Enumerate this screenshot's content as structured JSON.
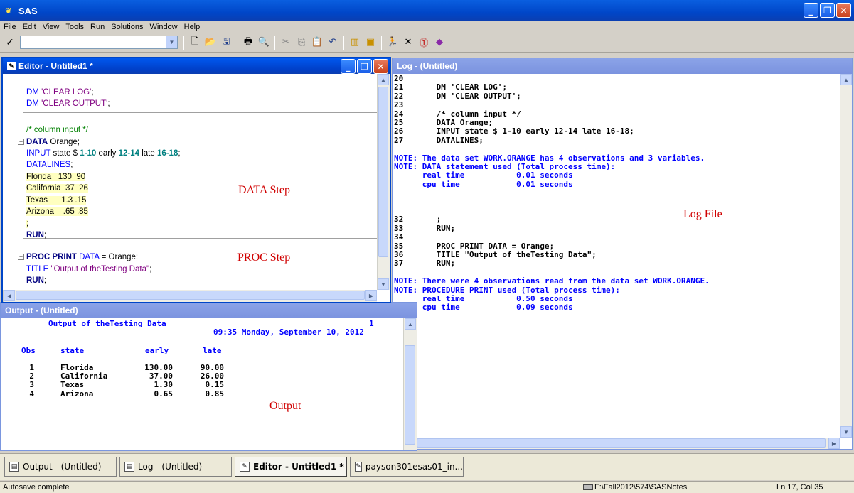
{
  "app": {
    "title": "SAS",
    "icon": "sas-app-icon"
  },
  "menu": [
    "File",
    "Edit",
    "View",
    "Tools",
    "Run",
    "Solutions",
    "Window",
    "Help"
  ],
  "toolbar": {
    "command_value": "",
    "icons": [
      "new-icon",
      "open-icon",
      "save-icon",
      "print-icon",
      "print-preview-icon",
      "cut-icon",
      "copy-icon",
      "paste-icon",
      "undo-icon",
      "new-library-icon",
      "explorer-icon",
      "submit-icon",
      "clear-icon",
      "break-icon",
      "help-icon"
    ]
  },
  "editor": {
    "title": "Editor - Untitled1 *",
    "lines": [
      {
        "parts": [
          {
            "t": "DM ",
            "c": "bl"
          },
          {
            "t": "'CLEAR LOG'",
            "c": "st"
          },
          {
            "t": ";",
            "c": ""
          }
        ]
      },
      {
        "parts": [
          {
            "t": "DM ",
            "c": "bl"
          },
          {
            "t": "'CLEAR OUTPUT'",
            "c": "st"
          },
          {
            "t": ";",
            "c": ""
          }
        ]
      },
      {
        "parts": []
      },
      {
        "parts": [
          {
            "t": "/* column input */",
            "c": "cm"
          }
        ]
      },
      {
        "parts": [
          {
            "t": "DATA",
            "c": "kw"
          },
          {
            "t": " Orange;",
            "c": ""
          }
        ]
      },
      {
        "parts": [
          {
            "t": "INPUT",
            "c": "bl"
          },
          {
            "t": " state $ ",
            "c": ""
          },
          {
            "t": "1-10",
            "c": "nm"
          },
          {
            "t": " early ",
            "c": ""
          },
          {
            "t": "12-14",
            "c": "nm"
          },
          {
            "t": " late ",
            "c": ""
          },
          {
            "t": "16-18",
            "c": "nm"
          },
          {
            "t": ";",
            "c": ""
          }
        ]
      },
      {
        "parts": [
          {
            "t": "DATALINES",
            "c": "bl"
          },
          {
            "t": ";",
            "c": ""
          }
        ]
      },
      {
        "parts": [
          {
            "t": "Florida   130  90",
            "c": "hl"
          }
        ]
      },
      {
        "parts": [
          {
            "t": "California  37  26",
            "c": "hl"
          }
        ]
      },
      {
        "parts": [
          {
            "t": "Texas      1.3 .15",
            "c": "hl"
          }
        ]
      },
      {
        "parts": [
          {
            "t": "Arizona    .65 .85",
            "c": "hl"
          }
        ]
      },
      {
        "parts": [
          {
            "t": ";",
            "c": "hl"
          }
        ]
      },
      {
        "parts": [
          {
            "t": "RUN",
            "c": "kw"
          },
          {
            "t": ";",
            "c": ""
          }
        ]
      },
      {
        "parts": []
      },
      {
        "parts": [
          {
            "t": "PROC PRINT",
            "c": "kw"
          },
          {
            "t": " DATA",
            "c": "bl"
          },
          {
            "t": " = Orange;",
            "c": ""
          }
        ]
      },
      {
        "parts": [
          {
            "t": "TITLE ",
            "c": "bl"
          },
          {
            "t": "\"Output of theTesting Data\"",
            "c": "st"
          },
          {
            "t": ";",
            "c": ""
          }
        ]
      },
      {
        "parts": [
          {
            "t": "RUN",
            "c": "kw"
          },
          {
            "t": ";",
            "c": ""
          }
        ]
      }
    ],
    "annotation_data": "DATA Step",
    "annotation_proc": "PROC Step"
  },
  "log": {
    "title": "Log - (Untitled)",
    "lines": [
      {
        "t": "20",
        "c": ""
      },
      {
        "t": "21       DM 'CLEAR LOG';",
        "c": ""
      },
      {
        "t": "22       DM 'CLEAR OUTPUT';",
        "c": ""
      },
      {
        "t": "23",
        "c": ""
      },
      {
        "t": "24       /* column input */",
        "c": ""
      },
      {
        "t": "25       DATA Orange;",
        "c": ""
      },
      {
        "t": "26       INPUT state $ 1-10 early 12-14 late 16-18;",
        "c": ""
      },
      {
        "t": "27       DATALINES;",
        "c": ""
      },
      {
        "t": "",
        "c": ""
      },
      {
        "t": "NOTE: The data set WORK.ORANGE has 4 observations and 3 variables.",
        "c": "blue"
      },
      {
        "t": "NOTE: DATA statement used (Total process time):",
        "c": "blue"
      },
      {
        "t": "      real time           0.01 seconds",
        "c": "blue"
      },
      {
        "t": "      cpu time            0.01 seconds",
        "c": "blue"
      },
      {
        "t": "",
        "c": ""
      },
      {
        "t": "",
        "c": ""
      },
      {
        "t": "",
        "c": ""
      },
      {
        "t": "32       ;",
        "c": ""
      },
      {
        "t": "33       RUN;",
        "c": ""
      },
      {
        "t": "34",
        "c": ""
      },
      {
        "t": "35       PROC PRINT DATA = Orange;",
        "c": ""
      },
      {
        "t": "36       TITLE \"Output of theTesting Data\";",
        "c": ""
      },
      {
        "t": "37       RUN;",
        "c": ""
      },
      {
        "t": "",
        "c": ""
      },
      {
        "t": "NOTE: There were 4 observations read from the data set WORK.ORANGE.",
        "c": "blue"
      },
      {
        "t": "NOTE: PROCEDURE PRINT used (Total process time):",
        "c": "blue"
      },
      {
        "t": "      real time           0.50 seconds",
        "c": "blue"
      },
      {
        "t": "      cpu time            0.09 seconds",
        "c": "blue"
      }
    ],
    "annotation": "Log File"
  },
  "output": {
    "title": "Output - (Untitled)",
    "heading": "Output of theTesting Data",
    "page": "1",
    "datetime": "09:35 Monday, September 10, 2012",
    "columns": [
      "Obs",
      "state",
      "early",
      "late"
    ],
    "rows": [
      [
        "1",
        "Florida",
        "130.00",
        "90.00"
      ],
      [
        "2",
        "California",
        "37.00",
        "26.00"
      ],
      [
        "3",
        "Texas",
        "1.30",
        "0.15"
      ],
      [
        "4",
        "Arizona",
        "0.65",
        "0.85"
      ]
    ],
    "annotation": "Output"
  },
  "taskbar": [
    {
      "label": "Output - (Untitled)",
      "icon": "output-window-icon"
    },
    {
      "label": "Log - (Untitled)",
      "icon": "log-window-icon"
    },
    {
      "label": "Editor - Untitled1 *",
      "icon": "editor-window-icon",
      "active": true
    },
    {
      "label": "payson301esas01_in...",
      "icon": "editor-window-icon"
    }
  ],
  "status": {
    "left": "Autosave complete",
    "path": "F:\\Fall2012\\574\\SASNotes",
    "position": "Ln 17, Col 35"
  }
}
